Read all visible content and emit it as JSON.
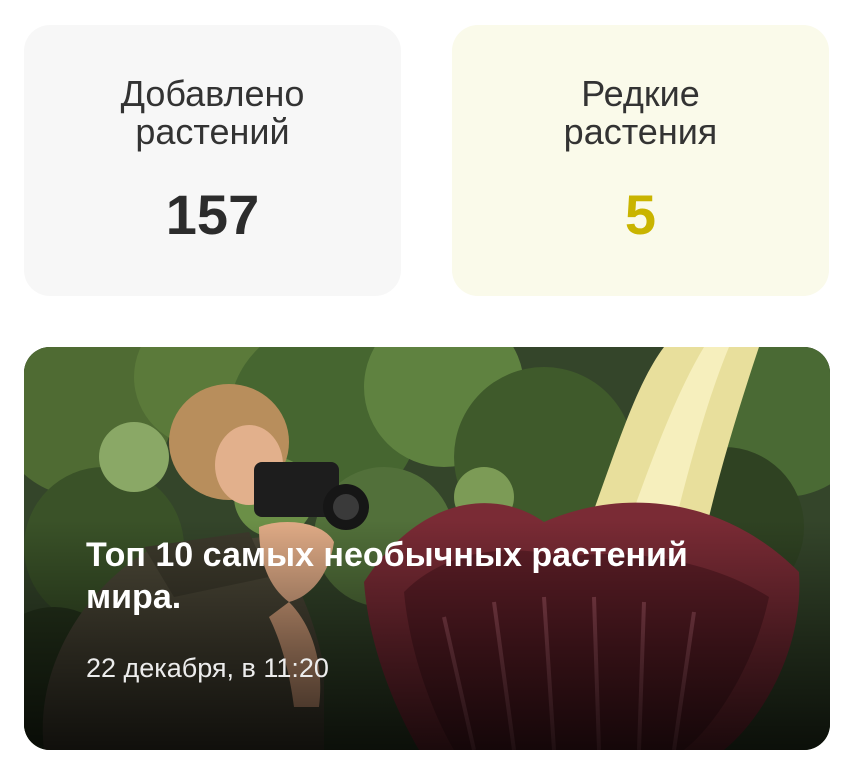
{
  "stats": {
    "plants_added": {
      "label": "Добавлено\nрастений",
      "value": "157",
      "value_color": "#2c2c2c",
      "background": "#f7f7f7"
    },
    "rare_plants": {
      "label": "Редкие\nрастения",
      "value": "5",
      "value_color": "#c9b400",
      "background": "#fafaea"
    }
  },
  "article": {
    "title": "Топ 10 самых необычных растений мира.",
    "date": "22 декабря, в 11:20",
    "image": "photographer-and-titan-arum-photo"
  }
}
